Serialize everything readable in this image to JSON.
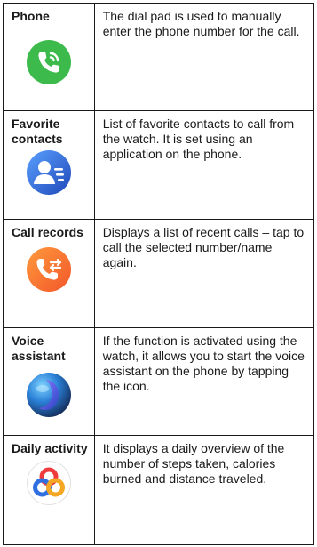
{
  "rows": [
    {
      "name": "Phone",
      "icon": "phone-icon",
      "description": "The dial pad is used to manually enter the phone number for the call."
    },
    {
      "name": "Favorite contacts",
      "icon": "favorite-contacts-icon",
      "description": "List of favorite contacts to call from the watch. It is set using an application on the phone."
    },
    {
      "name": "Call records",
      "icon": "call-records-icon",
      "description": "Displays a list of recent calls – tap to call the selected number/name again."
    },
    {
      "name": "Voice assistant",
      "icon": "voice-assistant-icon",
      "description": "If the function is activated using the watch, it allows you to start the voice assistant on the phone by tapping the icon."
    },
    {
      "name": "Daily activity",
      "icon": "daily-activity-icon",
      "description": "It displays a daily overview of the number of steps taken, calories burned and distance traveled."
    }
  ],
  "colors": {
    "phone_green": "#3cbb4c",
    "contacts_blue": "#2f5fd0",
    "call_records_orange": "#f47a2a",
    "voice_assistant_blue": "#2a7fd6",
    "activity_red": "#ef3b3b",
    "activity_blue": "#2f6fe0",
    "activity_orange": "#f5a623",
    "border": "#1a1a1a"
  }
}
